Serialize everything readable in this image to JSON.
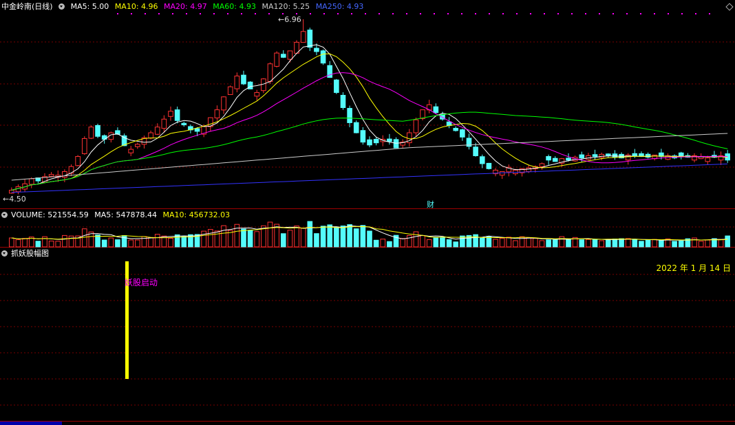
{
  "price_header": {
    "stock_name": "中金岭南",
    "period": "(日线)",
    "ma": [
      {
        "label": "MA5: 5.00",
        "color": "#ffffff"
      },
      {
        "label": "MA10: 4.96",
        "color": "#ffff00"
      },
      {
        "label": "MA20: 4.97",
        "color": "#ff00ff"
      },
      {
        "label": "MA60: 4.93",
        "color": "#00ff00"
      },
      {
        "label": "MA120: 5.25",
        "color": "#cccccc"
      },
      {
        "label": "MA250: 4.93",
        "color": "#3333ff"
      }
    ]
  },
  "volume_header": {
    "label": "VOLUME: 521554.59",
    "ma5": "MA5: 547878.44",
    "ma10": "MA10: 456732.03"
  },
  "indicator_header": {
    "label": "抓妖股幅图"
  },
  "indicator": {
    "date_label": "2022 年 1 月 14 日",
    "signal_label": "妖股启动"
  },
  "price_labels": {
    "high": "6.96",
    "low": "4.50"
  },
  "event_marker": "财",
  "colors": {
    "up": "#ff3232",
    "down": "#54fcfc",
    "grid": "#7a0000",
    "signal": "#ffff00",
    "signal_text": "#ff00ff"
  },
  "chart_data": {
    "type": "candlestick",
    "high": 6.96,
    "low": 4.5,
    "close": [
      4.58,
      4.63,
      4.67,
      4.74,
      4.71,
      4.77,
      4.8,
      4.79,
      4.84,
      4.91,
      5.05,
      5.3,
      5.46,
      5.33,
      5.29,
      5.38,
      5.36,
      5.2,
      5.15,
      5.22,
      5.31,
      5.38,
      5.46,
      5.57,
      5.68,
      5.55,
      5.49,
      5.42,
      5.4,
      5.47,
      5.59,
      5.7,
      5.88,
      6.02,
      6.17,
      6.06,
      5.99,
      5.94,
      6.13,
      6.34,
      6.49,
      6.43,
      6.52,
      6.64,
      6.79,
      6.57,
      6.51,
      6.35,
      6.15,
      5.94,
      5.73,
      5.52,
      5.38,
      5.25,
      5.21,
      5.24,
      5.29,
      5.26,
      5.17,
      5.25,
      5.38,
      5.56,
      5.7,
      5.77,
      5.66,
      5.57,
      5.48,
      5.41,
      5.32,
      5.19,
      5.06,
      4.95,
      4.88,
      4.86,
      4.84,
      4.9,
      4.86,
      4.88,
      4.89,
      4.91,
      4.95,
      5.0,
      4.98,
      5.02,
      5.0,
      5.04,
      5.03,
      5.06,
      5.05,
      5.08,
      5.06,
      5.04,
      5.03,
      5.07,
      5.06,
      5.05,
      5.04,
      5.07,
      5.05,
      5.06,
      5.03,
      5.05,
      5.04,
      5.06,
      5.05,
      5.03,
      5.04,
      5.06,
      5.0
    ]
  }
}
